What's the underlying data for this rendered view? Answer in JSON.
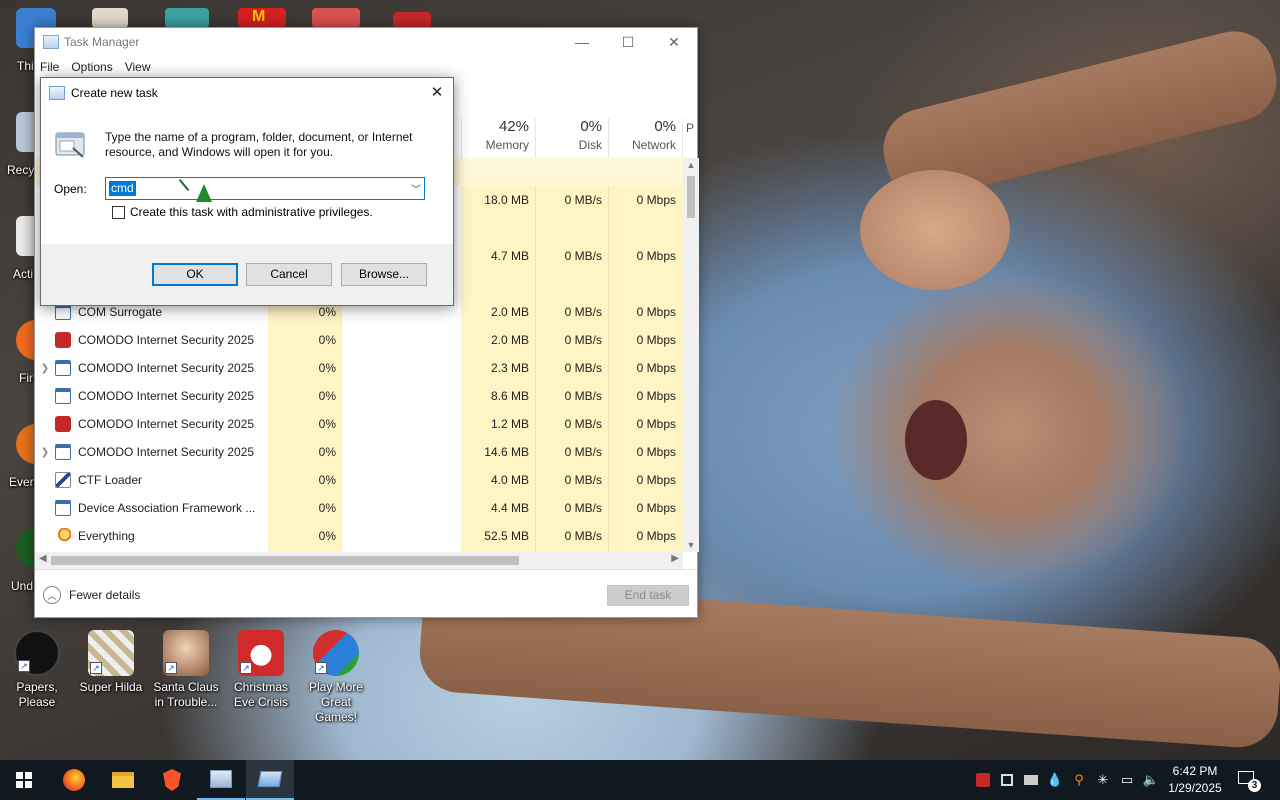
{
  "desktop": {
    "icons_bottom": [
      {
        "label": "Papers,\nPlease",
        "color": "#1a1a1a"
      },
      {
        "label": "Super Hilda",
        "color": "#e8e0c8"
      },
      {
        "label": "Santa Claus\nin Trouble...",
        "color": "#8a5a3a"
      },
      {
        "label": "Christmas\nEve Crisis",
        "color": "#c8282c"
      },
      {
        "label": "Play More\nGreat Games!",
        "color": "#2a7fd8"
      }
    ],
    "left_peek": [
      "Thi",
      "Recy",
      "Acti",
      "Fir",
      "Every",
      "Und"
    ]
  },
  "task_manager": {
    "title": "Task Manager",
    "menu": [
      "File",
      "Options",
      "View"
    ],
    "columns": [
      {
        "pct": "42%",
        "label": "Memory"
      },
      {
        "pct": "0%",
        "label": "Disk"
      },
      {
        "pct": "0%",
        "label": "Network"
      },
      {
        "pct": "",
        "label": "P"
      }
    ],
    "hidden_rows": [
      {
        "memory": "18.0 MB",
        "disk": "0 MB/s",
        "network": "0 Mbps"
      },
      {
        "memory": "4.7 MB",
        "disk": "0 MB/s",
        "network": "0 Mbps"
      }
    ],
    "rows": [
      {
        "name": "COM Surrogate",
        "cpu": "0%",
        "memory": "2.0 MB",
        "disk": "0 MB/s",
        "network": "0 Mbps",
        "expandable": false,
        "icon": "window-icon"
      },
      {
        "name": "COMODO Internet Security 2025",
        "cpu": "0%",
        "memory": "2.0 MB",
        "disk": "0 MB/s",
        "network": "0 Mbps",
        "expandable": false,
        "icon": "comodo-icon"
      },
      {
        "name": "COMODO Internet Security 2025",
        "cpu": "0%",
        "memory": "2.3 MB",
        "disk": "0 MB/s",
        "network": "0 Mbps",
        "expandable": true,
        "icon": "window-icon"
      },
      {
        "name": "COMODO Internet Security 2025",
        "cpu": "0%",
        "memory": "8.6 MB",
        "disk": "0 MB/s",
        "network": "0 Mbps",
        "expandable": false,
        "icon": "window-icon"
      },
      {
        "name": "COMODO Internet Security 2025",
        "cpu": "0%",
        "memory": "1.2 MB",
        "disk": "0 MB/s",
        "network": "0 Mbps",
        "expandable": false,
        "icon": "comodo-icon"
      },
      {
        "name": "COMODO Internet Security 2025",
        "cpu": "0%",
        "memory": "14.6 MB",
        "disk": "0 MB/s",
        "network": "0 Mbps",
        "expandable": true,
        "icon": "window-icon"
      },
      {
        "name": "CTF Loader",
        "cpu": "0%",
        "memory": "4.0 MB",
        "disk": "0 MB/s",
        "network": "0 Mbps",
        "expandable": false,
        "icon": "pen-icon"
      },
      {
        "name": "Device Association Framework ...",
        "cpu": "0%",
        "memory": "4.4 MB",
        "disk": "0 MB/s",
        "network": "0 Mbps",
        "expandable": false,
        "icon": "window-icon"
      },
      {
        "name": "Everything",
        "cpu": "0%",
        "memory": "52.5 MB",
        "disk": "0 MB/s",
        "network": "0 Mbps",
        "expandable": false,
        "icon": "magnifier-icon"
      }
    ],
    "fewer_details": "Fewer details",
    "end_task": "End task"
  },
  "dialog": {
    "title": "Create new task",
    "description": "Type the name of a program, folder, document, or Internet resource, and Windows will open it for you.",
    "open_label": "Open:",
    "open_value": "cmd",
    "admin_checkbox": "Create this task with administrative privileges.",
    "admin_checked": false,
    "ok": "OK",
    "cancel": "Cancel",
    "browse": "Browse..."
  },
  "taskbar": {
    "time": "6:42 PM",
    "date": "1/29/2025",
    "notification_count": "3"
  },
  "colors": {
    "accent": "#0078d7",
    "heat": "#fff4c4",
    "taskbar": "#101820"
  }
}
